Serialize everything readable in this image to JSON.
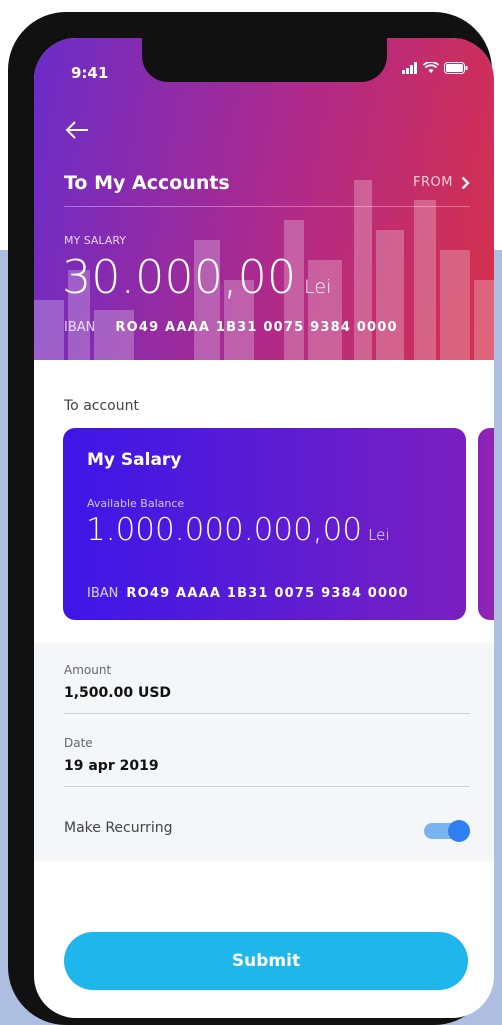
{
  "status_bar": {
    "time": "9:41"
  },
  "header": {
    "title": "To My Accounts",
    "from_label": "FROM",
    "account_label": "MY SALARY",
    "amount": "30.000,00",
    "currency": "Lei",
    "iban_label": "IBAN",
    "iban": "RO49 AAAA 1B31 0075 9384 0000"
  },
  "to_account": {
    "label": "To account",
    "card": {
      "name": "My Salary",
      "balance_label": "Available Balance",
      "balance": "1.000.000.000,00",
      "currency": "Lei",
      "iban_label": "IBAN",
      "iban": "RO49 AAAA 1B31 0075 9384 0000"
    }
  },
  "form": {
    "amount_label": "Amount",
    "amount_value": "1,500.00 USD",
    "date_label": "Date",
    "date_value": "19 apr 2019",
    "recurring_label": "Make Recurring",
    "recurring_on": true
  },
  "submit_label": "Submit",
  "colors": {
    "header_gradient": [
      "#6b2cc9",
      "#b02a8a",
      "#d6304b"
    ],
    "card_gradient": [
      "#3e16e8",
      "#7a1fc0"
    ],
    "submit": "#1fb6ec",
    "toggle": "#2f7ff0"
  }
}
